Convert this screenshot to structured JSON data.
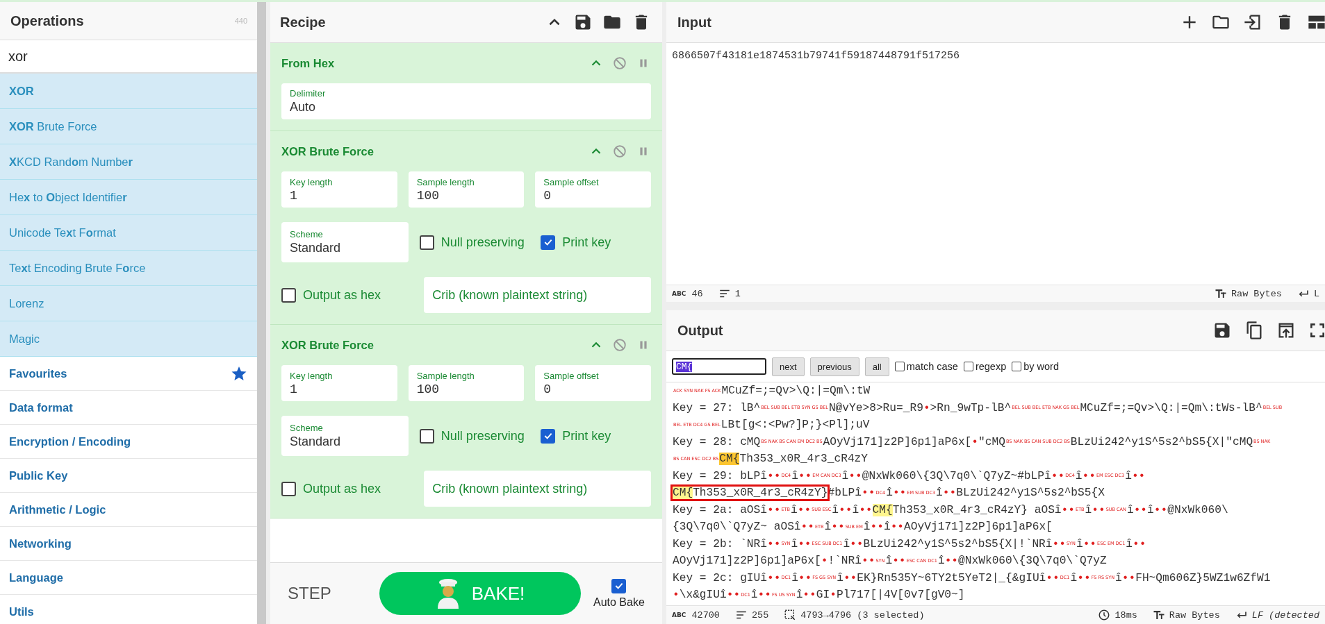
{
  "operations": {
    "title": "Operations",
    "count": "440",
    "search": {
      "value": "xor"
    },
    "results": [
      {
        "label": "**XOR**"
      },
      {
        "label": "**XOR** Brute Force"
      },
      {
        "label": "**X**KCD Rand**o**m Numbe**r**"
      },
      {
        "label": "He**x** to **O**bject Identifie**r**"
      },
      {
        "label": "Unicode Te**x**t F**o**rmat"
      },
      {
        "label": "Te**x**t Encoding Brute F**o**rce"
      },
      {
        "label": "Lorenz"
      },
      {
        "label": "Magic"
      }
    ],
    "categories": [
      {
        "label": "Favourites",
        "kind": "favourites"
      },
      {
        "label": "Data format",
        "kind": "category"
      },
      {
        "label": "Encryption / Encoding",
        "kind": "category"
      },
      {
        "label": "Public Key",
        "kind": "category"
      },
      {
        "label": "Arithmetic / Logic",
        "kind": "category"
      },
      {
        "label": "Networking",
        "kind": "category"
      },
      {
        "label": "Language",
        "kind": "category"
      },
      {
        "label": "Utils",
        "kind": "category"
      }
    ]
  },
  "recipe": {
    "title": "Recipe",
    "operations": [
      {
        "name": "From Hex",
        "rows": [
          [
            {
              "kind": "field",
              "label": "Delimiter",
              "value": "Auto"
            }
          ]
        ]
      },
      {
        "name": "XOR Brute Force",
        "rows": [
          [
            {
              "kind": "field",
              "label": "Key length",
              "value": "1"
            },
            {
              "kind": "field",
              "label": "Sample length",
              "value": "100"
            },
            {
              "kind": "field",
              "label": "Sample offset",
              "value": "0"
            }
          ],
          [
            {
              "kind": "field",
              "label": "Scheme",
              "value": "Standard"
            },
            {
              "kind": "checkbox",
              "label": "Null preserving",
              "checked": false
            },
            {
              "kind": "checkbox",
              "label": "Print key",
              "checked": true
            }
          ],
          [
            {
              "kind": "checkbox",
              "label": "Output as hex",
              "checked": false
            },
            {
              "kind": "input",
              "placeholder": "Crib (known plaintext string)"
            }
          ]
        ]
      },
      {
        "name": "XOR Brute Force",
        "rows": [
          [
            {
              "kind": "field",
              "label": "Key length",
              "value": "1"
            },
            {
              "kind": "field",
              "label": "Sample length",
              "value": "100"
            },
            {
              "kind": "field",
              "label": "Sample offset",
              "value": "0"
            }
          ],
          [
            {
              "kind": "field",
              "label": "Scheme",
              "value": "Standard"
            },
            {
              "kind": "checkbox",
              "label": "Null preserving",
              "checked": false
            },
            {
              "kind": "checkbox",
              "label": "Print key",
              "checked": true
            }
          ],
          [
            {
              "kind": "checkbox",
              "label": "Output as hex",
              "checked": false
            },
            {
              "kind": "input",
              "placeholder": "Crib (known plaintext string)"
            }
          ]
        ]
      }
    ],
    "step": "STEP",
    "bake": "BAKE!",
    "auto_bake": {
      "label": "Auto Bake",
      "checked": true
    }
  },
  "input": {
    "title": "Input",
    "value": "6866507f43181e1874531b79741f59187448791f517256",
    "status": {
      "length_icon": "ABC",
      "length": "46",
      "lines": "1",
      "encoding": "Raw Bytes",
      "eol": "L"
    }
  },
  "output": {
    "title": "Output",
    "find": {
      "value": "CM{",
      "buttons": [
        "next",
        "previous",
        "all"
      ],
      "options": [
        {
          "label": "match case",
          "checked": false
        },
        {
          "label": "regexp",
          "checked": false
        },
        {
          "label": "by word",
          "checked": false
        }
      ]
    },
    "lines": [
      [
        {
          "kind": "ctrl",
          "text": "ACK"
        },
        {
          "kind": "ctrl",
          "text": "SYN"
        },
        {
          "kind": "ctrl",
          "text": "NAK"
        },
        {
          "kind": "ctrl",
          "text": "FS"
        },
        {
          "kind": "ctrl",
          "text": "ACK"
        },
        {
          "kind": "text",
          "text": "MCuZf=;=Qv>\\Q:|=Qm\\:tW"
        }
      ],
      [
        {
          "kind": "text",
          "text": "Key = 27: lB^"
        },
        {
          "kind": "ctrl",
          "text": "BEL"
        },
        {
          "kind": "ctrl",
          "text": "SUB"
        },
        {
          "kind": "ctrl",
          "text": "BEL"
        },
        {
          "kind": "ctrl",
          "text": "ETB"
        },
        {
          "kind": "ctrl",
          "text": "SYN"
        },
        {
          "kind": "ctrl",
          "text": "GS"
        },
        {
          "kind": "ctrl",
          "text": "BEL"
        },
        {
          "kind": "text",
          "text": "N@vYe>8>Ru=_R9"
        },
        {
          "kind": "dot",
          "text": "•"
        },
        {
          "kind": "text",
          "text": ">Rn_9wTp-lB^"
        },
        {
          "kind": "ctrl",
          "text": "BEL"
        },
        {
          "kind": "ctrl",
          "text": "SUB"
        },
        {
          "kind": "ctrl",
          "text": "BEL"
        },
        {
          "kind": "ctrl",
          "text": "ETB"
        },
        {
          "kind": "ctrl",
          "text": "NAK"
        },
        {
          "kind": "ctrl",
          "text": "GS"
        },
        {
          "kind": "ctrl",
          "text": "BEL"
        },
        {
          "kind": "text",
          "text": "MCuZf=;=Qv>\\Q:|=Qm\\:tWs-lB^"
        },
        {
          "kind": "ctrl",
          "text": "BEL"
        },
        {
          "kind": "ctrl",
          "text": "SUB"
        }
      ],
      [
        {
          "kind": "ctrl",
          "text": "BEL"
        },
        {
          "kind": "ctrl",
          "text": "ETB"
        },
        {
          "kind": "ctrl",
          "text": "DC4"
        },
        {
          "kind": "ctrl",
          "text": "GS"
        },
        {
          "kind": "ctrl",
          "text": "BEL"
        },
        {
          "kind": "text",
          "text": "LBt[g<:<Pw?]P;}<Pl];uV"
        }
      ],
      [
        {
          "kind": "text",
          "text": "Key = 28: cMQ"
        },
        {
          "kind": "ctrl",
          "text": "BS"
        },
        {
          "kind": "ctrl",
          "text": "NAK"
        },
        {
          "kind": "ctrl",
          "text": "BS"
        },
        {
          "kind": "ctrl",
          "text": "CAN"
        },
        {
          "kind": "ctrl",
          "text": "EM"
        },
        {
          "kind": "ctrl",
          "text": "DC2"
        },
        {
          "kind": "ctrl",
          "text": "BS"
        },
        {
          "kind": "text",
          "text": "AOyVj171]z2P]6p1]aP6x["
        },
        {
          "kind": "dot",
          "text": "•"
        },
        {
          "kind": "text",
          "text": "\"cMQ"
        },
        {
          "kind": "ctrl",
          "text": "BS"
        },
        {
          "kind": "ctrl",
          "text": "NAK"
        },
        {
          "kind": "ctrl",
          "text": "BS"
        },
        {
          "kind": "ctrl",
          "text": "CAN"
        },
        {
          "kind": "ctrl",
          "text": "SUB"
        },
        {
          "kind": "ctrl",
          "text": "DC2"
        },
        {
          "kind": "ctrl",
          "text": "BS"
        },
        {
          "kind": "text",
          "text": "BLzUi242^y1S^5s2^bS5{X|\"cMQ"
        },
        {
          "kind": "ctrl",
          "text": "BS"
        },
        {
          "kind": "ctrl",
          "text": "NAK"
        }
      ],
      [
        {
          "kind": "ctrl",
          "text": "BS"
        },
        {
          "kind": "ctrl",
          "text": "CAN"
        },
        {
          "kind": "ctrl",
          "text": "ESC"
        },
        {
          "kind": "ctrl",
          "text": "DC2"
        },
        {
          "kind": "ctrl",
          "text": "BS"
        },
        {
          "kind": "current",
          "text": "CM{"
        },
        {
          "kind": "text",
          "text": "Th353_x0R_4r3_cR4zY"
        }
      ],
      [
        {
          "kind": "text",
          "text": "Key = 29: bLPî"
        },
        {
          "kind": "dot",
          "text": "••"
        },
        {
          "kind": "ctrl",
          "text": "DC4"
        },
        {
          "kind": "text",
          "text": "î"
        },
        {
          "kind": "dot",
          "text": "••"
        },
        {
          "kind": "ctrl",
          "text": "EM"
        },
        {
          "kind": "ctrl",
          "text": "CAN"
        },
        {
          "kind": "ctrl",
          "text": "DC3"
        },
        {
          "kind": "text",
          "text": "î"
        },
        {
          "kind": "dot",
          "text": "••"
        },
        {
          "kind": "text",
          "text": "@NxWk060\\{3Q\\7q0\\`Q7yZ~#bLPî"
        },
        {
          "kind": "dot",
          "text": "••"
        },
        {
          "kind": "ctrl",
          "text": "DC4"
        },
        {
          "kind": "text",
          "text": "î"
        },
        {
          "kind": "dot",
          "text": "••"
        },
        {
          "kind": "ctrl",
          "text": "EM"
        },
        {
          "kind": "ctrl",
          "text": "ESC"
        },
        {
          "kind": "ctrl",
          "text": "DC3"
        },
        {
          "kind": "text",
          "text": "î"
        },
        {
          "kind": "dot",
          "text": "••"
        }
      ],
      [
        {
          "kind": "boxed",
          "segments": [
            {
              "kind": "match",
              "text": "CM{"
            },
            {
              "kind": "text",
              "text": "Th353_x0R_4r3_cR4zY}"
            }
          ]
        },
        {
          "kind": "text",
          "text": "#bLPî"
        },
        {
          "kind": "dot",
          "text": "••"
        },
        {
          "kind": "ctrl",
          "text": "DC4"
        },
        {
          "kind": "text",
          "text": "î"
        },
        {
          "kind": "dot",
          "text": "••"
        },
        {
          "kind": "ctrl",
          "text": "EM"
        },
        {
          "kind": "ctrl",
          "text": "SUB"
        },
        {
          "kind": "ctrl",
          "text": "DC3"
        },
        {
          "kind": "text",
          "text": "î"
        },
        {
          "kind": "dot",
          "text": "••"
        },
        {
          "kind": "text",
          "text": "BLzUi242^y1S^5s2^bS5{X"
        }
      ],
      [
        {
          "kind": "text",
          "text": "Key = 2a: aOSî"
        },
        {
          "kind": "dot",
          "text": "••"
        },
        {
          "kind": "ctrl",
          "text": "ETB"
        },
        {
          "kind": "text",
          "text": "î"
        },
        {
          "kind": "dot",
          "text": "••"
        },
        {
          "kind": "ctrl",
          "text": "SUB"
        },
        {
          "kind": "ctrl",
          "text": "ESC"
        },
        {
          "kind": "text",
          "text": "î"
        },
        {
          "kind": "dot",
          "text": "••"
        },
        {
          "kind": "text",
          "text": "î"
        },
        {
          "kind": "dot",
          "text": "••"
        },
        {
          "kind": "match",
          "text": "CM{"
        },
        {
          "kind": "text",
          "text": "Th353_x0R_4r3_cR4zY} aOSî"
        },
        {
          "kind": "dot",
          "text": "••"
        },
        {
          "kind": "ctrl",
          "text": "ETB"
        },
        {
          "kind": "text",
          "text": "î"
        },
        {
          "kind": "dot",
          "text": "••"
        },
        {
          "kind": "ctrl",
          "text": "SUB"
        },
        {
          "kind": "ctrl",
          "text": "CAN"
        },
        {
          "kind": "text",
          "text": "î"
        },
        {
          "kind": "dot",
          "text": "••"
        },
        {
          "kind": "text",
          "text": "î"
        },
        {
          "kind": "dot",
          "text": "••"
        },
        {
          "kind": "text",
          "text": "@NxWk060\\"
        }
      ],
      [
        {
          "kind": "text",
          "text": "{3Q\\7q0\\`Q7yZ~ aOSî"
        },
        {
          "kind": "dot",
          "text": "••"
        },
        {
          "kind": "ctrl",
          "text": "ETB"
        },
        {
          "kind": "text",
          "text": "î"
        },
        {
          "kind": "dot",
          "text": "••"
        },
        {
          "kind": "ctrl",
          "text": "SUB"
        },
        {
          "kind": "ctrl",
          "text": "EM"
        },
        {
          "kind": "text",
          "text": "î"
        },
        {
          "kind": "dot",
          "text": "••"
        },
        {
          "kind": "text",
          "text": "î"
        },
        {
          "kind": "dot",
          "text": "••"
        },
        {
          "kind": "text",
          "text": "AOyVj171]z2P]6p1]aP6x["
        }
      ],
      [
        {
          "kind": "text",
          "text": "Key = 2b: `NRî"
        },
        {
          "kind": "dot",
          "text": "••"
        },
        {
          "kind": "ctrl",
          "text": "SYN"
        },
        {
          "kind": "text",
          "text": "î"
        },
        {
          "kind": "dot",
          "text": "••"
        },
        {
          "kind": "ctrl",
          "text": "ESC"
        },
        {
          "kind": "ctrl",
          "text": "SUB"
        },
        {
          "kind": "ctrl",
          "text": "DC1"
        },
        {
          "kind": "text",
          "text": "î"
        },
        {
          "kind": "dot",
          "text": "••"
        },
        {
          "kind": "text",
          "text": "BLzUi242^y1S^5s2^bS5{X|!`NRî"
        },
        {
          "kind": "dot",
          "text": "••"
        },
        {
          "kind": "ctrl",
          "text": "SYN"
        },
        {
          "kind": "text",
          "text": "î"
        },
        {
          "kind": "dot",
          "text": "••"
        },
        {
          "kind": "ctrl",
          "text": "ESC"
        },
        {
          "kind": "ctrl",
          "text": "EM"
        },
        {
          "kind": "ctrl",
          "text": "DC1"
        },
        {
          "kind": "text",
          "text": "î"
        },
        {
          "kind": "dot",
          "text": "••"
        }
      ],
      [
        {
          "kind": "text",
          "text": "AOyVj171]z2P]6p1]aP6x["
        },
        {
          "kind": "dot",
          "text": "•"
        },
        {
          "kind": "text",
          "text": "!`NRî"
        },
        {
          "kind": "dot",
          "text": "••"
        },
        {
          "kind": "ctrl",
          "text": "SYN"
        },
        {
          "kind": "text",
          "text": "î"
        },
        {
          "kind": "dot",
          "text": "••"
        },
        {
          "kind": "ctrl",
          "text": "ESC"
        },
        {
          "kind": "ctrl",
          "text": "CAN"
        },
        {
          "kind": "ctrl",
          "text": "DC1"
        },
        {
          "kind": "text",
          "text": "î"
        },
        {
          "kind": "dot",
          "text": "••"
        },
        {
          "kind": "text",
          "text": "@NxWk060\\{3Q\\7q0\\`Q7yZ"
        }
      ],
      [
        {
          "kind": "text",
          "text": "Key = 2c: gIUî"
        },
        {
          "kind": "dot",
          "text": "••"
        },
        {
          "kind": "ctrl",
          "text": "DC1"
        },
        {
          "kind": "text",
          "text": "î"
        },
        {
          "kind": "dot",
          "text": "••"
        },
        {
          "kind": "ctrl",
          "text": "FS"
        },
        {
          "kind": "ctrl",
          "text": "GS"
        },
        {
          "kind": "ctrl",
          "text": "SYN"
        },
        {
          "kind": "text",
          "text": "î"
        },
        {
          "kind": "dot",
          "text": "••"
        },
        {
          "kind": "text",
          "text": "EK}Rn535Y~6TY2t5YeT2|_{&gIUî"
        },
        {
          "kind": "dot",
          "text": "••"
        },
        {
          "kind": "ctrl",
          "text": "DC1"
        },
        {
          "kind": "text",
          "text": "î"
        },
        {
          "kind": "dot",
          "text": "••"
        },
        {
          "kind": "ctrl",
          "text": "FS"
        },
        {
          "kind": "ctrl",
          "text": "RS"
        },
        {
          "kind": "ctrl",
          "text": "SYN"
        },
        {
          "kind": "text",
          "text": "î"
        },
        {
          "kind": "dot",
          "text": "••"
        },
        {
          "kind": "text",
          "text": "FH~Qm606Z}5WZ1w6ZfW1"
        }
      ],
      [
        {
          "kind": "dot",
          "text": "•"
        },
        {
          "kind": "text",
          "text": "\\x&gIUî"
        },
        {
          "kind": "dot",
          "text": "••"
        },
        {
          "kind": "ctrl",
          "text": "DC1"
        },
        {
          "kind": "text",
          "text": "î"
        },
        {
          "kind": "dot",
          "text": "••"
        },
        {
          "kind": "ctrl",
          "text": "FS"
        },
        {
          "kind": "ctrl",
          "text": "US"
        },
        {
          "kind": "ctrl",
          "text": "SYN"
        },
        {
          "kind": "text",
          "text": "î"
        },
        {
          "kind": "dot",
          "text": "••"
        },
        {
          "kind": "text",
          "text": "GI"
        },
        {
          "kind": "dot",
          "text": "•"
        },
        {
          "kind": "text",
          "text": "Pl717[|4V[0v7[gV0~]"
        }
      ]
    ],
    "status": {
      "length_icon": "ABC",
      "length": "42700",
      "lines": "255",
      "selection": "4793→4796 (3 selected)",
      "time": "18ms",
      "encoding": "Raw Bytes",
      "eol": "LF (detected"
    }
  }
}
